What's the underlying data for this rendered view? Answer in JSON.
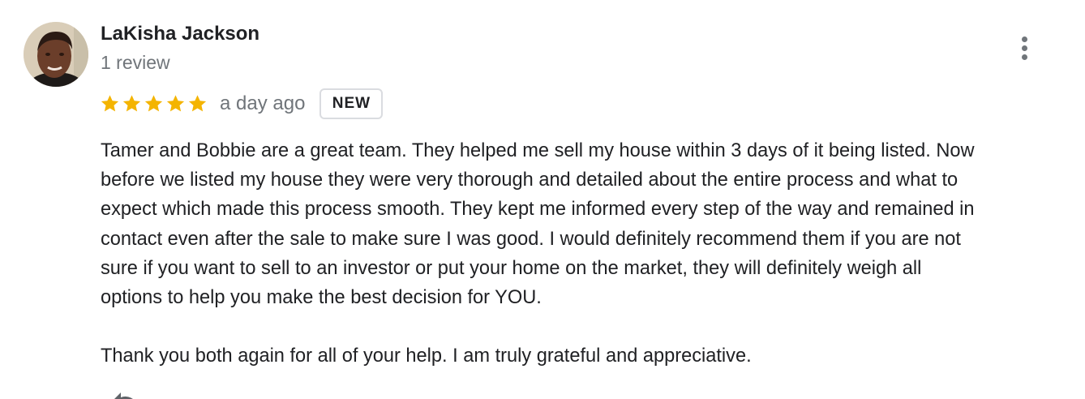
{
  "reviewer": {
    "name": "LaKisha Jackson",
    "review_count": "1 review",
    "avatar": "reviewer-photo"
  },
  "rating": {
    "stars": 5,
    "max_stars": 5,
    "timestamp": "a day ago",
    "badge": "NEW"
  },
  "review": {
    "lines": [
      "Tamer and Bobbie are a great team. They helped  me sell my house within 3 days of it being listed. Now",
      "before we listed my house they were very thorough and detailed about the entire process and what to",
      "expect which made this process smooth. They kept me informed every step of the way and remained in",
      "contact even after the sale to make sure I was good. I would definitely recommend them if you are not",
      "sure if you want to sell to an investor or put your home on the market, they will definitely weigh all",
      "options to help you make the best decision for YOU."
    ],
    "closing": "Thank you both again for all of your help. I am truly grateful and appreciative."
  },
  "icons": {
    "more": "more-vert-icon",
    "share": "share-icon",
    "star": "star-icon"
  },
  "colors": {
    "star": "#f4b400",
    "secondary_text": "#70757a",
    "primary_text": "#202124",
    "badge_border": "#dadce0"
  }
}
